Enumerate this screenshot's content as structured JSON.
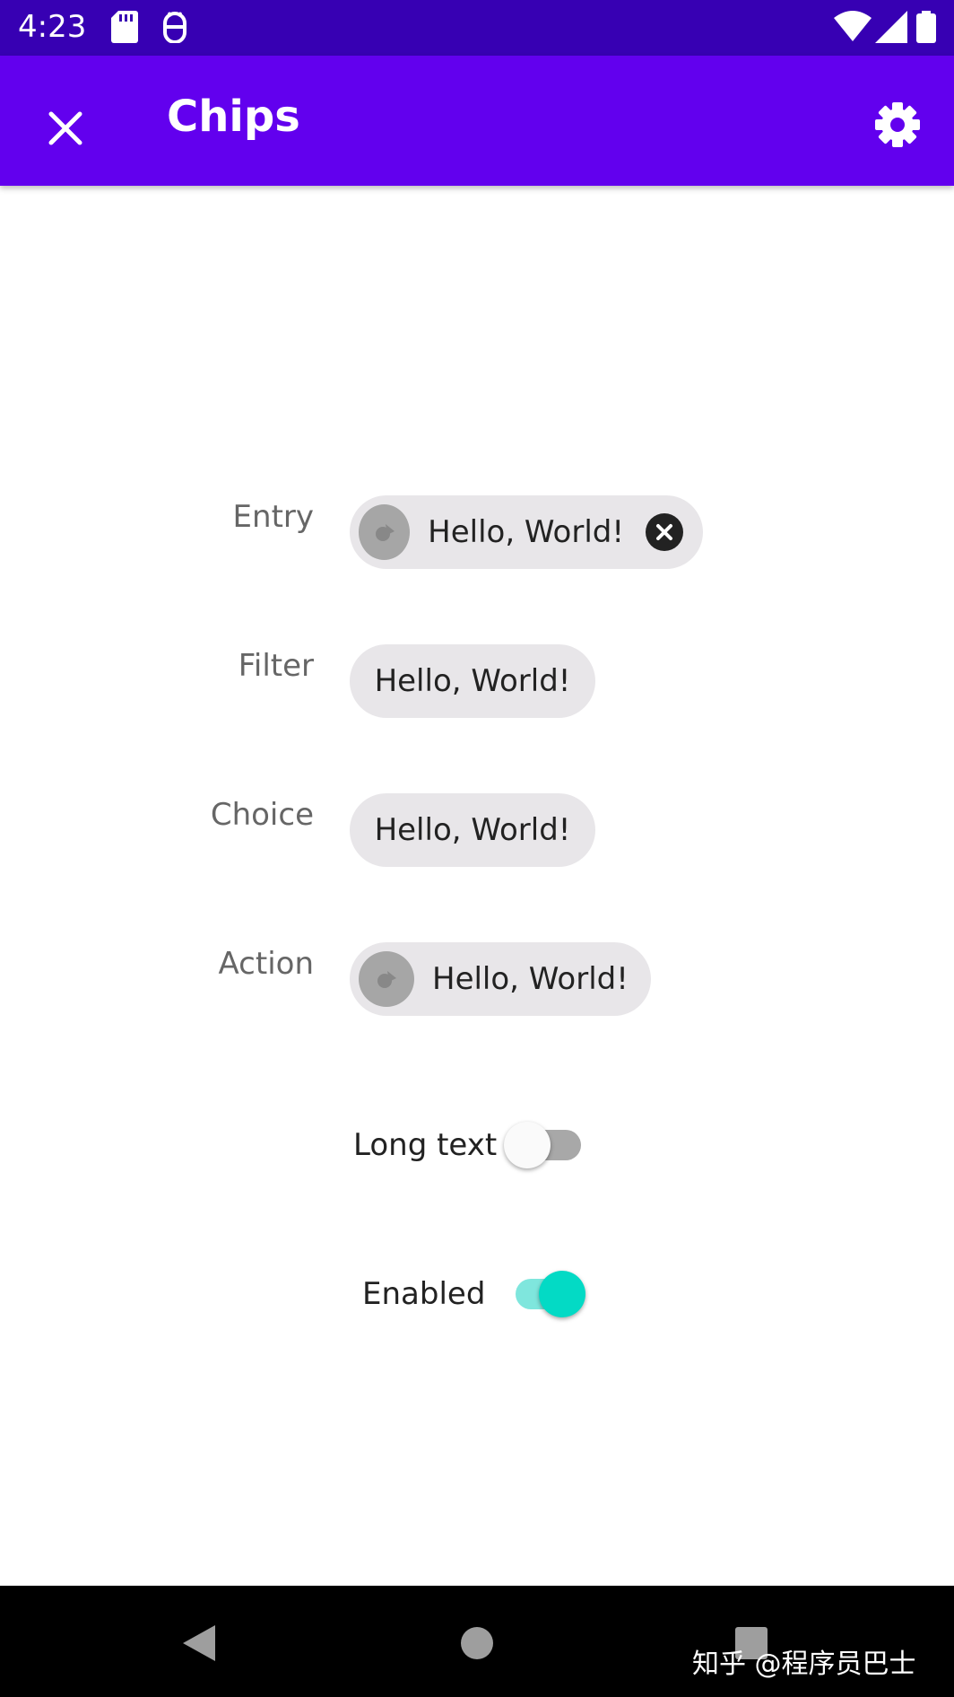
{
  "status_bar": {
    "time": "4:23",
    "icons": [
      "sd-card-icon",
      "android-debug-icon",
      "wifi-icon",
      "signal-icon",
      "battery-icon"
    ]
  },
  "app_bar": {
    "title": "Chips",
    "close_icon": "close-icon",
    "settings_icon": "gear-icon"
  },
  "chips": [
    {
      "label": "Entry",
      "text": "Hello, World!",
      "has_avatar": true,
      "has_close": true
    },
    {
      "label": "Filter",
      "text": "Hello, World!",
      "has_avatar": false,
      "has_close": false
    },
    {
      "label": "Choice",
      "text": "Hello, World!",
      "has_avatar": false,
      "has_close": false
    },
    {
      "label": "Action",
      "text": "Hello, World!",
      "has_avatar": true,
      "has_close": false
    }
  ],
  "switches": [
    {
      "label": "Long text",
      "checked": false
    },
    {
      "label": "Enabled",
      "checked": true
    }
  ],
  "nav_bar": {
    "icons": [
      "back-icon",
      "home-icon",
      "recents-icon"
    ]
  },
  "watermark": "知乎 @程序员巴士",
  "colors": {
    "status_bar": "#3700b3",
    "app_bar": "#6200ee",
    "chip_bg": "#e8e6e9",
    "switch_on_thumb": "#03dac5",
    "switch_on_track": "#7fe6dd",
    "switch_off_thumb": "#fafafa",
    "switch_off_track": "#a8a8a8"
  }
}
